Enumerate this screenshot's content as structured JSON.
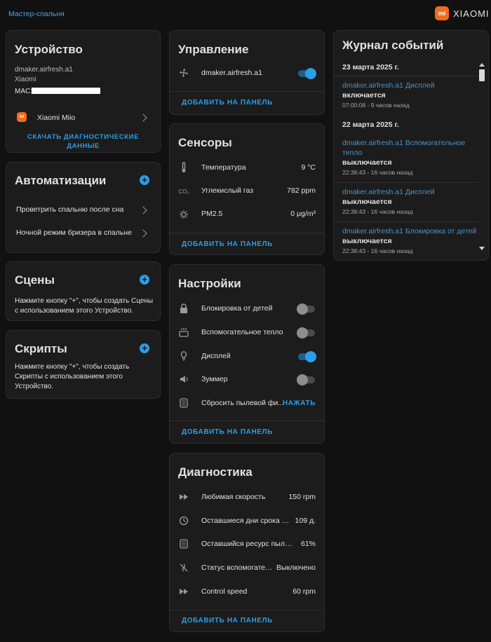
{
  "header": {
    "title": "Мастер-спальня",
    "brand": "XIAOMI",
    "brand_logo": "mi"
  },
  "device": {
    "title": "Устройство",
    "model": "dmaker.airfresh.a1",
    "manufacturer": "Xiaomi",
    "mac_label": "MAC:",
    "integration": "Xiaomi Miio",
    "diagnostics_line1": "СКАЧАТЬ ДИАГНОСТИЧЕСКИЕ",
    "diagnostics_line2": "ДАННЫЕ"
  },
  "automations": {
    "title": "Автоматизации",
    "items": [
      {
        "label": "Проветрить спальню после сна"
      },
      {
        "label": "Ночной режим бризера в спальне"
      }
    ]
  },
  "scenes": {
    "title": "Сцены",
    "line1": "Нажмите кнопку \"+\", чтобы создать Сцены",
    "line2": "с использованием этого Устройство."
  },
  "scripts": {
    "title": "Скрипты",
    "line1": "Нажмите кнопку \"+\", чтобы создать",
    "line2": "Скрипты с использованием этого",
    "line3": "Устройство."
  },
  "control": {
    "title": "Управление",
    "entity": "dmaker.airfresh.a1",
    "add_label": "ДОБАВИТЬ НА ПАНЕЛЬ"
  },
  "sensors": {
    "title": "Сенсоры",
    "rows": [
      {
        "label": "Температура",
        "value": "9 °C",
        "icon": "thermometer-icon"
      },
      {
        "label": "Углекислый газ",
        "value": "782 ppm",
        "icon": "co2-icon"
      },
      {
        "label": "PM2.5",
        "value": "0 μg/m³",
        "icon": "pm25-icon"
      }
    ],
    "add_label": "ДОБАВИТЬ НА ПАНЕЛЬ"
  },
  "settings": {
    "title": "Настройки",
    "rows": [
      {
        "label": "Блокировка от детей",
        "state": "off",
        "icon": "lock-icon"
      },
      {
        "label": "Вспомогательное тепло",
        "state": "off",
        "icon": "heater-icon"
      },
      {
        "label": "Дисплей",
        "state": "on",
        "icon": "lightbulb-icon"
      },
      {
        "label": "Зуммер",
        "state": "off",
        "icon": "volume-icon"
      }
    ],
    "reset_label": "Сбросить пылевой фи...",
    "reset_action": "НАЖАТЬ",
    "add_label": "ДОБАВИТЬ НА ПАНЕЛЬ"
  },
  "diagnostics": {
    "title": "Диагностика",
    "rows": [
      {
        "label": "Любимая скорость",
        "value": "150 rpm",
        "icon": "fast-forward-icon"
      },
      {
        "label": "Оставшиеся дни срока сл...",
        "value": "109 д.",
        "icon": "clock-icon"
      },
      {
        "label": "Оставшийся ресурс пылево...",
        "value": "61%",
        "icon": "filter-icon"
      },
      {
        "label": "Статус вспомогател...",
        "value": "Выключено",
        "icon": "heater-off-icon"
      },
      {
        "label": "Control speed",
        "value": "60 rpm",
        "icon": "fast-forward-icon"
      }
    ],
    "add_label": "ДОБАВИТЬ НА ПАНЕЛЬ"
  },
  "log": {
    "title": "Журнал событий",
    "groups": [
      {
        "date": "23 марта 2025 г.",
        "entries": [
          {
            "title": "dmaker.airfresh.a1 Дисплей",
            "state": "включается",
            "time": "07:00:08 - 9 часов назад"
          }
        ]
      },
      {
        "date": "22 марта 2025 г.",
        "entries": [
          {
            "title": "dmaker.airfresh.a1 Вспомогательное тепло",
            "state": "выключается",
            "time": "22:38:43 - 16 часов назад"
          },
          {
            "title": "dmaker.airfresh.a1 Дисплей",
            "state": "выключается",
            "time": "22:38:43 - 16 часов назад"
          },
          {
            "title": "dmaker.airfresh.a1 Блокировка от детей",
            "state": "выключается",
            "time": "22:38:43 - 16 часов назад"
          }
        ]
      }
    ]
  },
  "colors": {
    "accent": "#2a9ee8",
    "card": "#1c1c1c",
    "background": "#111111",
    "brand": "#f26b1d"
  }
}
